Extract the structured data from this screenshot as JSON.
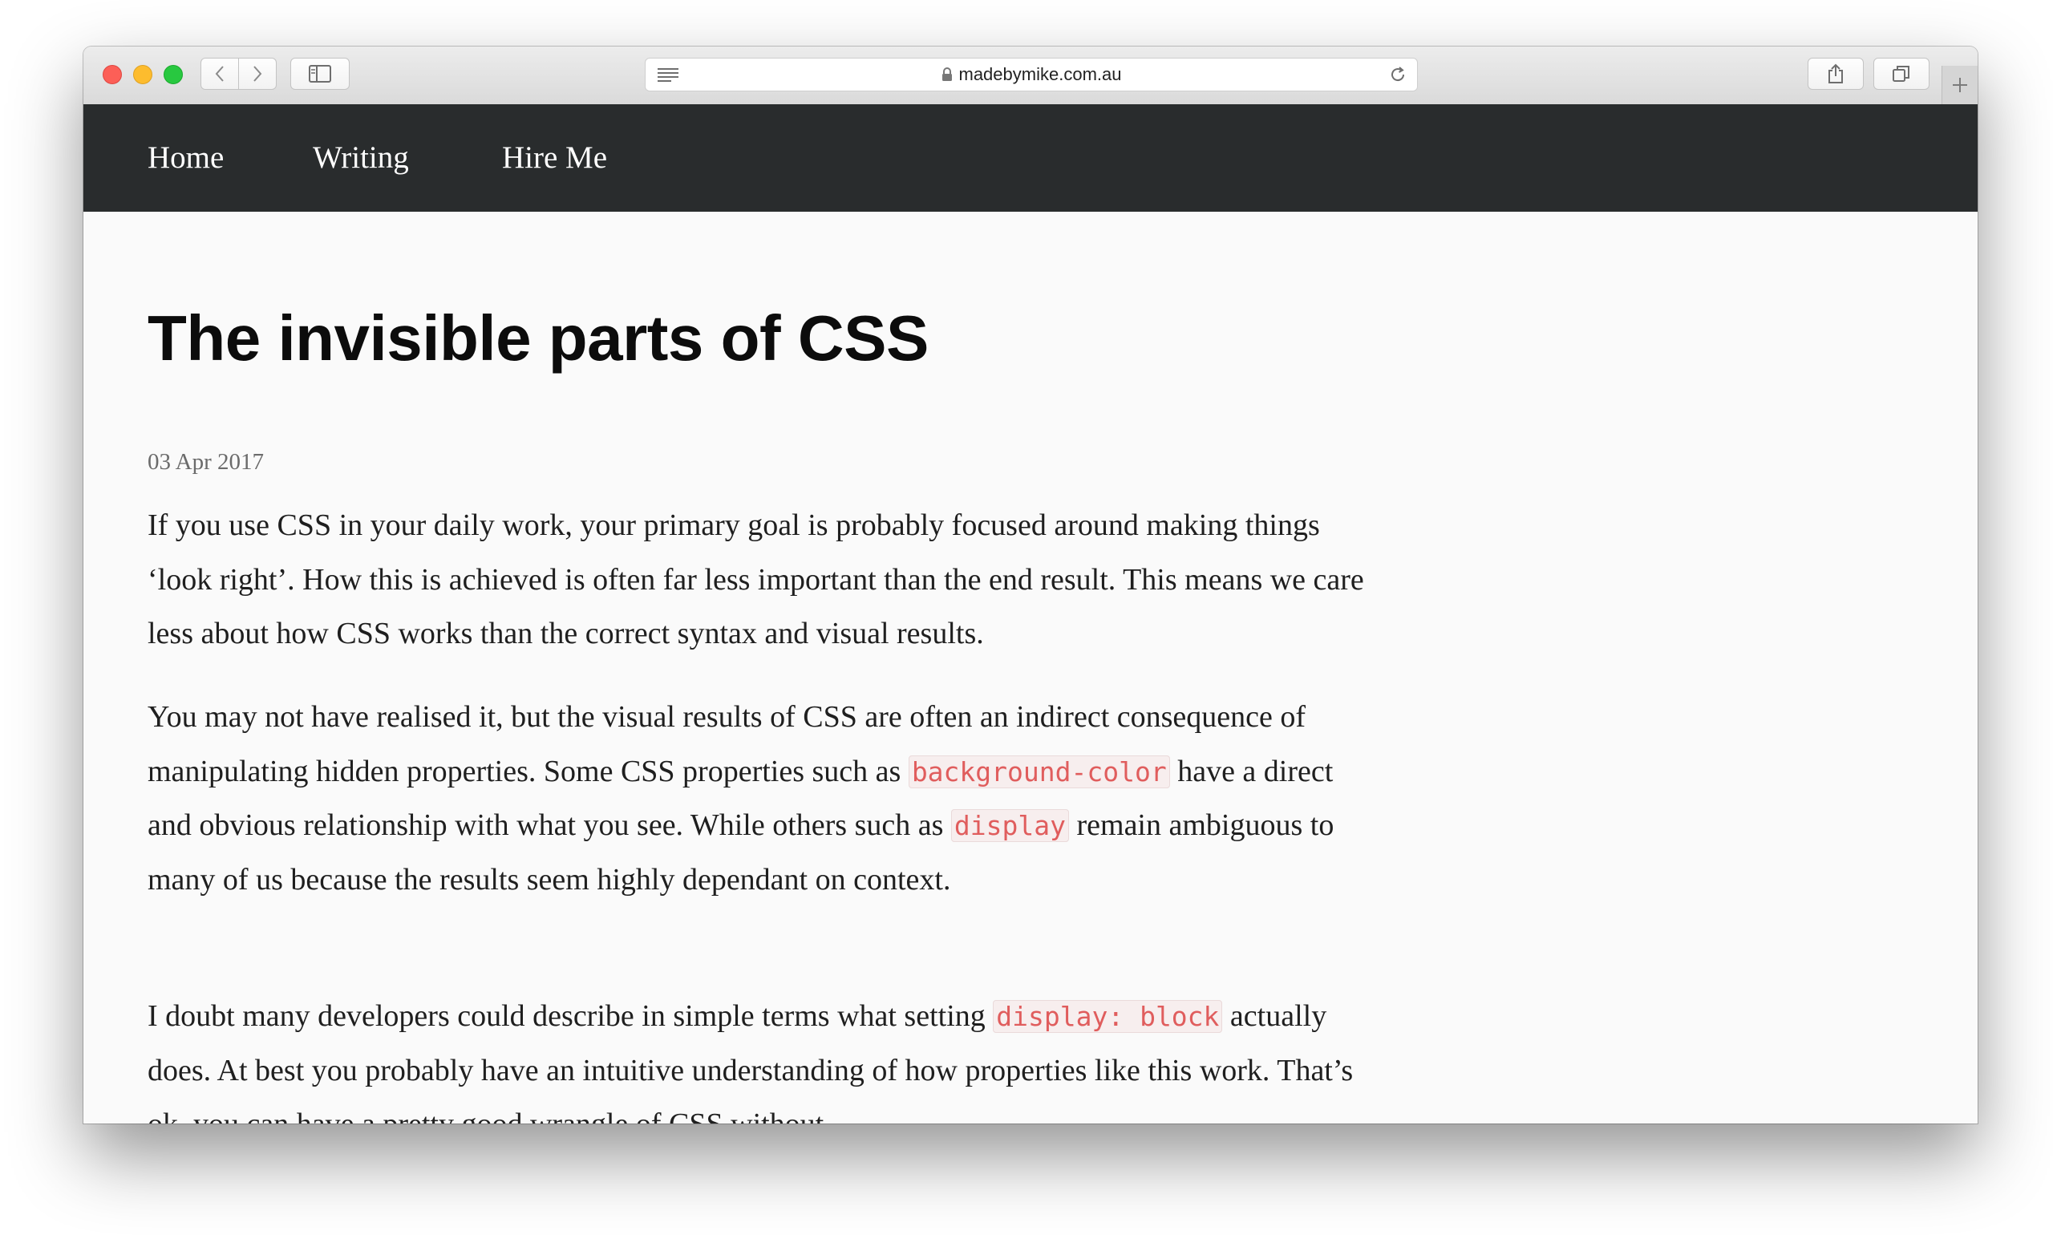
{
  "browser": {
    "url": "madebymike.com.au",
    "icons": [
      "back-icon",
      "forward-icon",
      "sidebar-icon",
      "reader-icon",
      "lock-icon",
      "reload-icon",
      "share-icon",
      "tabs-icon",
      "plus-icon"
    ]
  },
  "nav": {
    "items": [
      {
        "label": "Home"
      },
      {
        "label": "Writing"
      },
      {
        "label": "Hire Me"
      }
    ]
  },
  "article": {
    "title": "The invisible parts of CSS",
    "date": "03 Apr 2017",
    "p1": "If you use CSS in your daily work, your primary goal is probably focused around making things ‘look right’. How this is achieved is often far less important than the end result. This means we care less about how CSS works than the correct syntax and visual results.",
    "p2_a": "You may not have realised it, but the visual results of CSS are often an indirect consequence of manipulating hidden properties. Some CSS properties such as ",
    "p2_code1": "background-color",
    "p2_b": " have a direct and obvious relationship with what you see. While others such as ",
    "p2_code2": "display",
    "p2_c": " remain ambiguous to many of us because the results seem highly dependant on context.",
    "p3_a": "I doubt many developers could describe in simple terms what setting ",
    "p3_code": "display: block",
    "p3_b": " actually does. At best you probably have an intuitive understanding of how properties like this work. That’s ok, you can have a pretty good wrangle of CSS without"
  },
  "colors": {
    "nav_bg": "#292c2d",
    "code_text": "#e05d5d",
    "page_bg": "#fafafa"
  }
}
